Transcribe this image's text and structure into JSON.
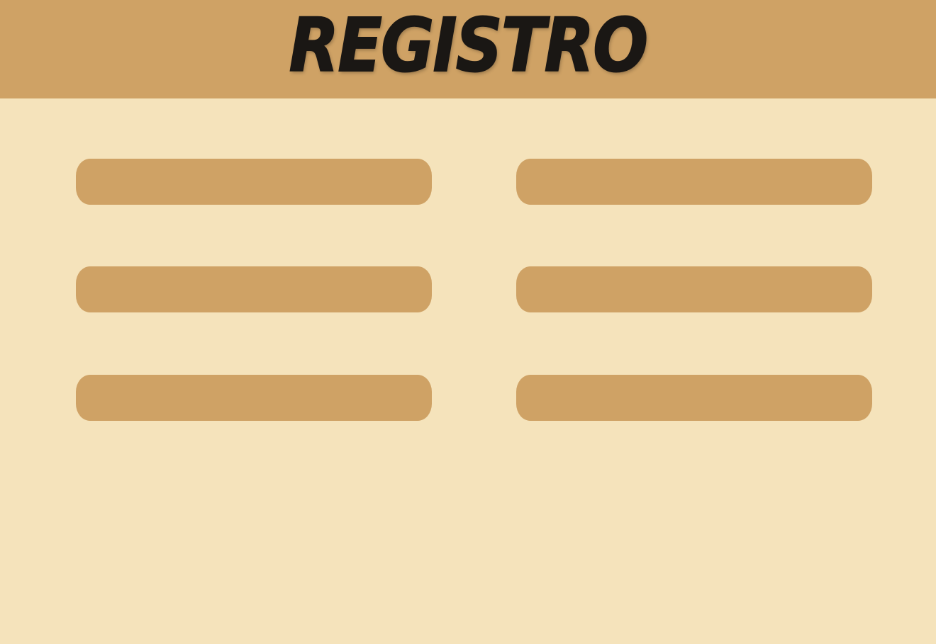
{
  "header": {
    "title": "REGISTRO"
  },
  "form": {
    "fields": [
      {
        "value": "",
        "placeholder": ""
      },
      {
        "value": "",
        "placeholder": ""
      },
      {
        "value": "",
        "placeholder": ""
      },
      {
        "value": "",
        "placeholder": ""
      },
      {
        "value": "",
        "placeholder": ""
      },
      {
        "value": "",
        "placeholder": ""
      }
    ]
  },
  "colors": {
    "background": "#f5e3bb",
    "accent": "#cfa265",
    "title_text": "#1a1714"
  }
}
